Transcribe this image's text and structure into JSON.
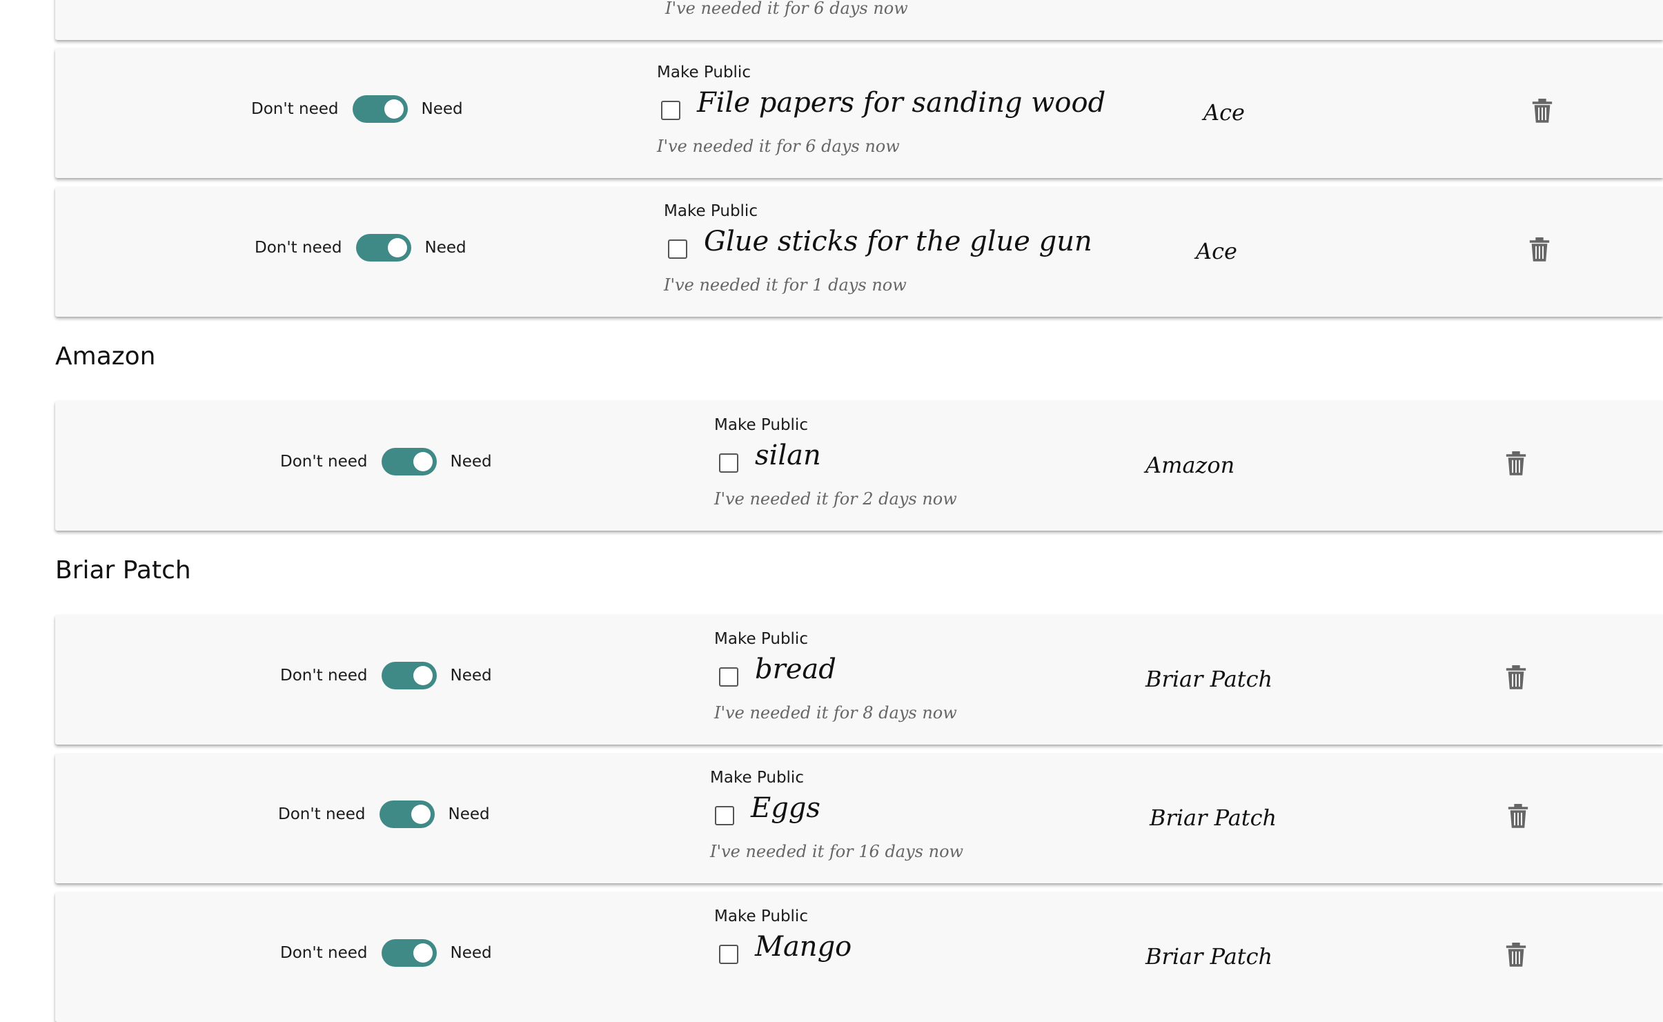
{
  "labels": {
    "dont_need": "Don't need",
    "need": "Need",
    "make_public": "Make Public"
  },
  "items": [
    {
      "since": "I've needed it for 6 days now"
    },
    {
      "name": "File papers for sanding wood",
      "store": "Ace",
      "since": "I've needed it for 6 days now",
      "need": true,
      "public": false
    },
    {
      "name": "Glue sticks for the glue gun",
      "store": "Ace",
      "since": "I've needed it for 1 days now",
      "need": true,
      "public": false
    },
    {
      "name": "silan",
      "store": "Amazon",
      "since": "I've needed it for 2 days now",
      "need": true,
      "public": false
    },
    {
      "name": "bread",
      "store": "Briar Patch",
      "since": "I've needed it for 8 days now",
      "need": true,
      "public": false
    },
    {
      "name": "Eggs",
      "store": "Briar Patch",
      "since": "I've needed it for 16 days now",
      "need": true,
      "public": false
    },
    {
      "name": "Mango",
      "store": "Briar Patch",
      "need": true,
      "public": false
    }
  ],
  "sections": {
    "amazon": "Amazon",
    "briar_patch": "Briar Patch"
  },
  "colors": {
    "toggle_on": "#3f8a87",
    "card_bg": "#f8f8f8"
  },
  "icons": {
    "delete": "trash-icon"
  }
}
